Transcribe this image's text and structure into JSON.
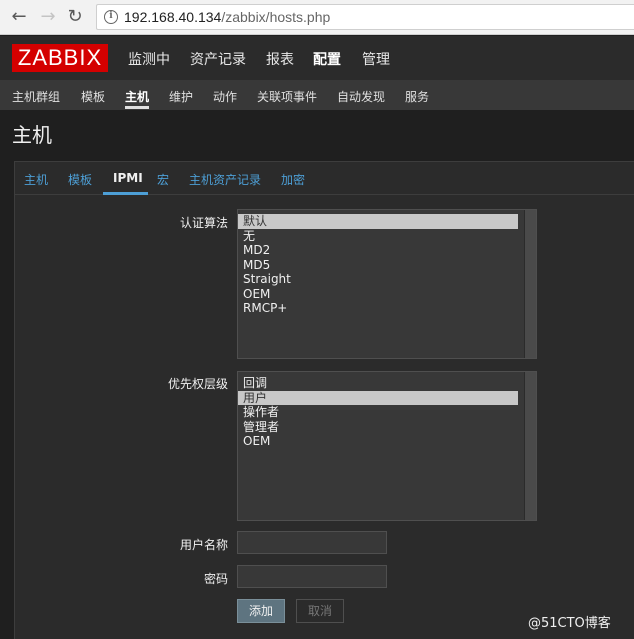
{
  "browser": {
    "url_host": "192.168.40.134",
    "url_path": "/zabbix/hosts.php"
  },
  "header": {
    "logo": "ZABBIX",
    "main_menu": [
      "监测中",
      "资产记录",
      "报表",
      "配置",
      "管理"
    ],
    "sub_menu": [
      "主机群组",
      "模板",
      "主机",
      "维护",
      "动作",
      "关联项事件",
      "自动发现",
      "服务"
    ]
  },
  "page": {
    "title": "主机"
  },
  "tabs": [
    "主机",
    "模板",
    "IPMI",
    "宏",
    "主机资产记录",
    "加密"
  ],
  "form": {
    "auth_label": "认证算法",
    "auth_options": [
      "默认",
      "无",
      "MD2",
      "MD5",
      "Straight",
      "OEM",
      "RMCP+"
    ],
    "auth_selected": "默认",
    "privilege_label": "优先权层级",
    "privilege_options": [
      "回调",
      "用户",
      "操作者",
      "管理者",
      "OEM"
    ],
    "privilege_selected": "用户",
    "username_label": "用户名称",
    "username_value": "",
    "password_label": "密码",
    "password_value": "",
    "add_button": "添加",
    "cancel_button": "取消"
  },
  "watermark": "@51CTO博客"
}
